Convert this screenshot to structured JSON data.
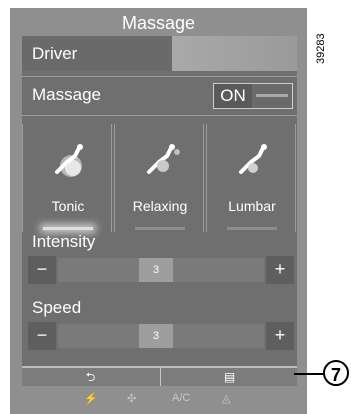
{
  "header": {
    "title": "Massage"
  },
  "tabs": {
    "driver": "Driver"
  },
  "massage": {
    "label": "Massage",
    "toggle": "ON"
  },
  "modes": [
    {
      "label": "Tonic"
    },
    {
      "label": "Relaxing"
    },
    {
      "label": "Lumbar"
    }
  ],
  "intensity": {
    "label": "Intensity",
    "minus": "−",
    "value": "3",
    "plus": "+"
  },
  "speed": {
    "label": "Speed",
    "minus": "−",
    "value": "3",
    "plus": "+"
  },
  "bottombar": {
    "back_icon": "back-arrow-icon",
    "menu_icon": "menu-icon"
  },
  "climate": {
    "ac_label": "A/C"
  },
  "figure": {
    "code": "39283",
    "callout": "7"
  },
  "colors": {
    "screen": "#8f8f8f",
    "panel": "#6f6f6f"
  }
}
